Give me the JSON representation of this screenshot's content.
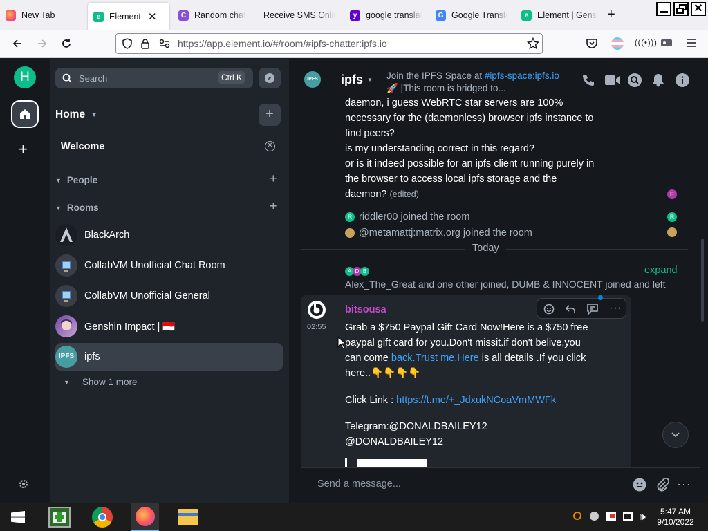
{
  "browser": {
    "tabs": [
      {
        "title": "New Tab"
      },
      {
        "title": "Element | ipfs"
      },
      {
        "title": "Random chat"
      },
      {
        "title": "Receive SMS Online"
      },
      {
        "title": "google translate"
      },
      {
        "title": "Google Translate"
      },
      {
        "title": "Element | Gensh"
      }
    ],
    "url": "https://app.element.io/#/room/#ipfs-chatter:ipfs.io"
  },
  "spaces": {
    "avatar_letter": "H"
  },
  "left": {
    "search_placeholder": "Search",
    "search_shortcut": "Ctrl K",
    "home_label": "Home",
    "welcome_label": "Welcome",
    "people_label": "People",
    "rooms_label": "Rooms",
    "rooms": [
      {
        "name": "BlackArch"
      },
      {
        "name": "CollabVM Unofficial Chat Room"
      },
      {
        "name": "CollabVM Unofficial General"
      },
      {
        "name": "Genshin Impact | 🇮🇩"
      },
      {
        "name": "ipfs",
        "avatar_text": "IPFS"
      }
    ],
    "show_more": "Show 1 more"
  },
  "room": {
    "name": "ipfs",
    "topic_line1_prefix": "Join the IPFS Space at ",
    "topic_line1_link": "#ipfs-space:ipfs.io",
    "topic_line2": "🚀 |This room is bridged to...",
    "prev_message": [
      "daemon, i guess WebRTC star servers are 100%",
      "necessary for the  (daemonless) browser ipfs instance to",
      "find peers?",
      "is my understanding correct in this regard?",
      "or is it indeed possible for an ipfs client running purely in",
      "the browser to access local ipfs storage and the",
      "daemon?"
    ],
    "edited_label": "(edited)",
    "events": [
      {
        "text": "riddler00 joined the room",
        "avatar_letter": "R"
      },
      {
        "text": "@metamattj:matrix.org joined the room"
      }
    ],
    "read_receipt_letter": "E",
    "read_receipt_letter2": "R",
    "date_separator": "Today",
    "summary_avatars": [
      "A",
      "D",
      "B"
    ],
    "summary_expand": "expand",
    "summary_text": "Alex_The_Great and one other joined, DUMB & INNOCENT joined and left",
    "message": {
      "sender": "bitsousa",
      "time": "02:55",
      "line1": "Grab a $750 Paypal Gift Card Now!Here is a $750 free",
      "line2": "paypal gift card for you.Don't missit.if don't belive,you",
      "line3_prefix": "can come ",
      "line3_link": "back.Trust me.Here",
      "line3_suffix": " is all details .If you click",
      "line4": "here..👇👇👇👇",
      "click_label": "Click Link : ",
      "click_link": "https://t.me/+_JdxukNCoaVmMWFk",
      "telegram1": "Telegram:@DONALDBAILEY12",
      "telegram2": "@DONALDBAILEY12"
    },
    "composer_placeholder": "Send a message..."
  },
  "taskbar": {
    "time": "5:47 AM",
    "date": "9/10/2022"
  },
  "colors": {
    "accent": "#0dbd8b",
    "sender": "#c74bd2",
    "link": "#3ea2ff"
  }
}
